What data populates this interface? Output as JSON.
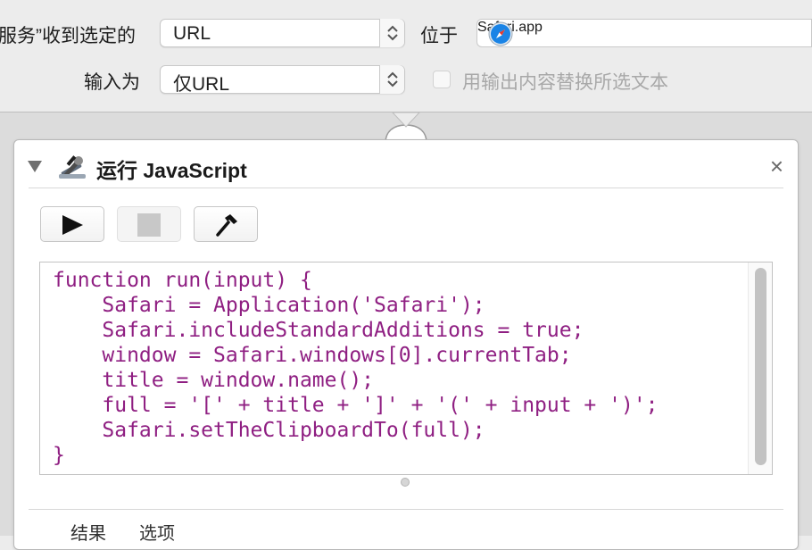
{
  "workflow": {
    "receives_label": "服务”收到选定的",
    "receives_value": "URL",
    "location_label": "位于",
    "location_app": "Safari.app",
    "input_label": "输入为",
    "input_value": "仅URL",
    "replace_label": "用输出内容替换所选文本",
    "replace_checked": false
  },
  "action": {
    "title": "运行 JavaScript",
    "close_glyph": "×",
    "code_lines": [
      "function run(input) {",
      "    Safari = Application('Safari');",
      "    Safari.includeStandardAdditions = true;",
      "    window = Safari.windows[0].currentTab;",
      "    title = window.name();",
      "    full = '[' + title + ']' + '(' + input + ')';",
      "    Safari.setTheClipboardTo(full);",
      "}"
    ],
    "tabs": [
      "结果",
      "选项"
    ]
  },
  "colors": {
    "code_text": "#8f1f82",
    "safari_blue": "#1a84e6"
  },
  "icons": {
    "run": "play-icon",
    "stop": "stop-icon",
    "compile": "hammer-icon",
    "action": "script-tools-icon"
  }
}
